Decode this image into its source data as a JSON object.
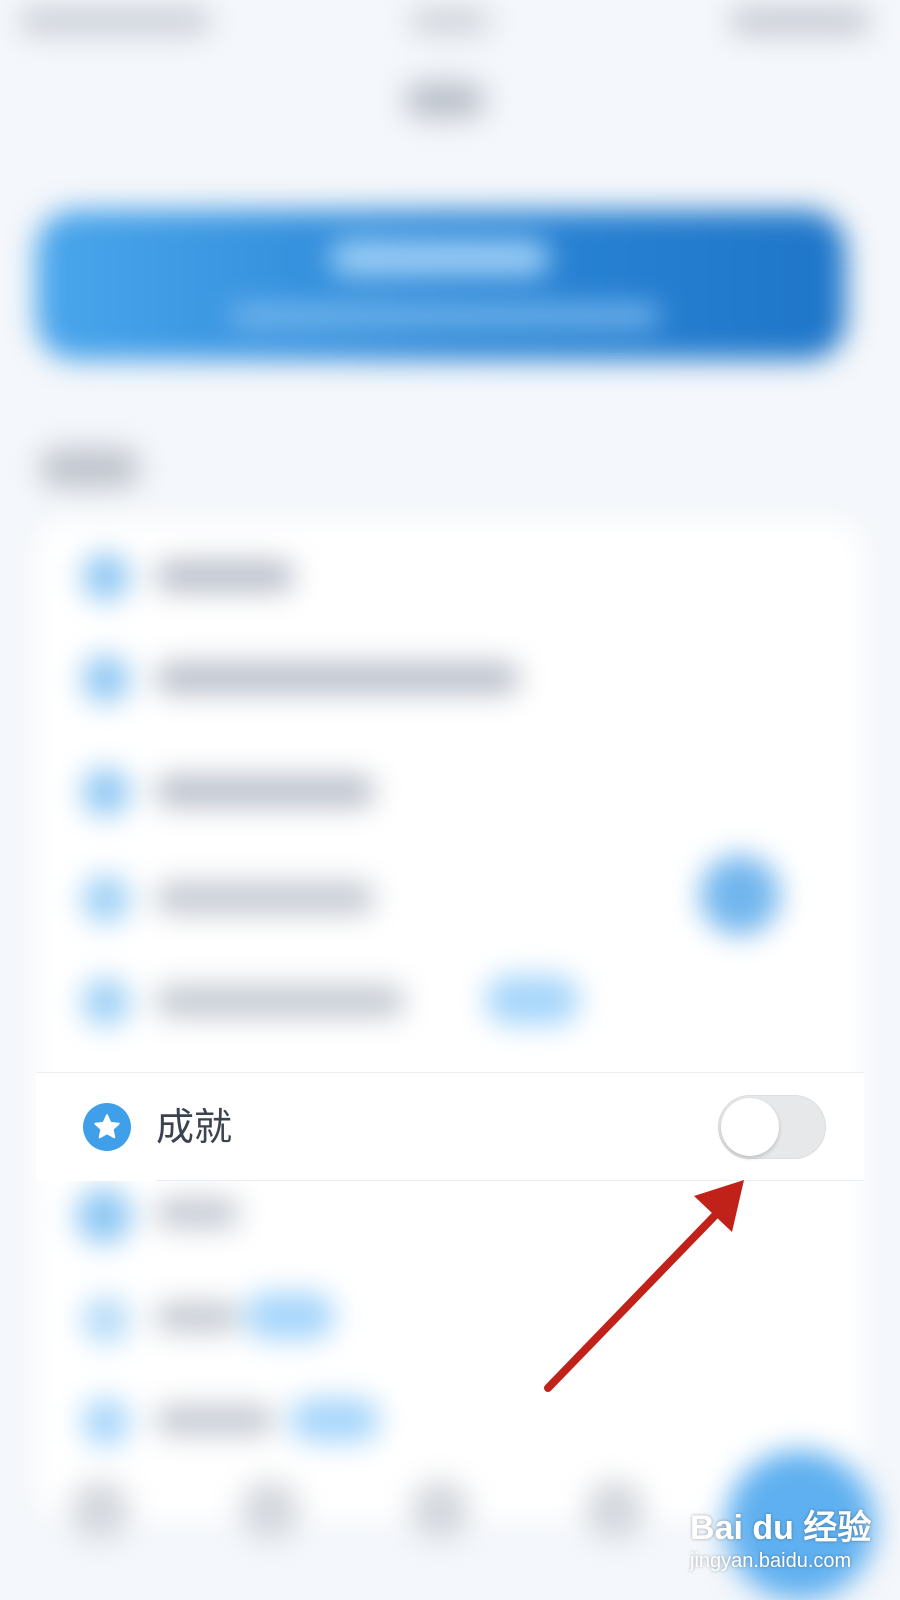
{
  "settings_row": {
    "label": "成就",
    "icon": "star-icon",
    "toggle_on": false
  },
  "watermark": {
    "brand": "Bai du 经验",
    "url": "jingyan.baidu.com"
  },
  "colors": {
    "accent": "#3f9fe8",
    "banner": "#2f8fe0",
    "arrow": "#c0221a"
  }
}
